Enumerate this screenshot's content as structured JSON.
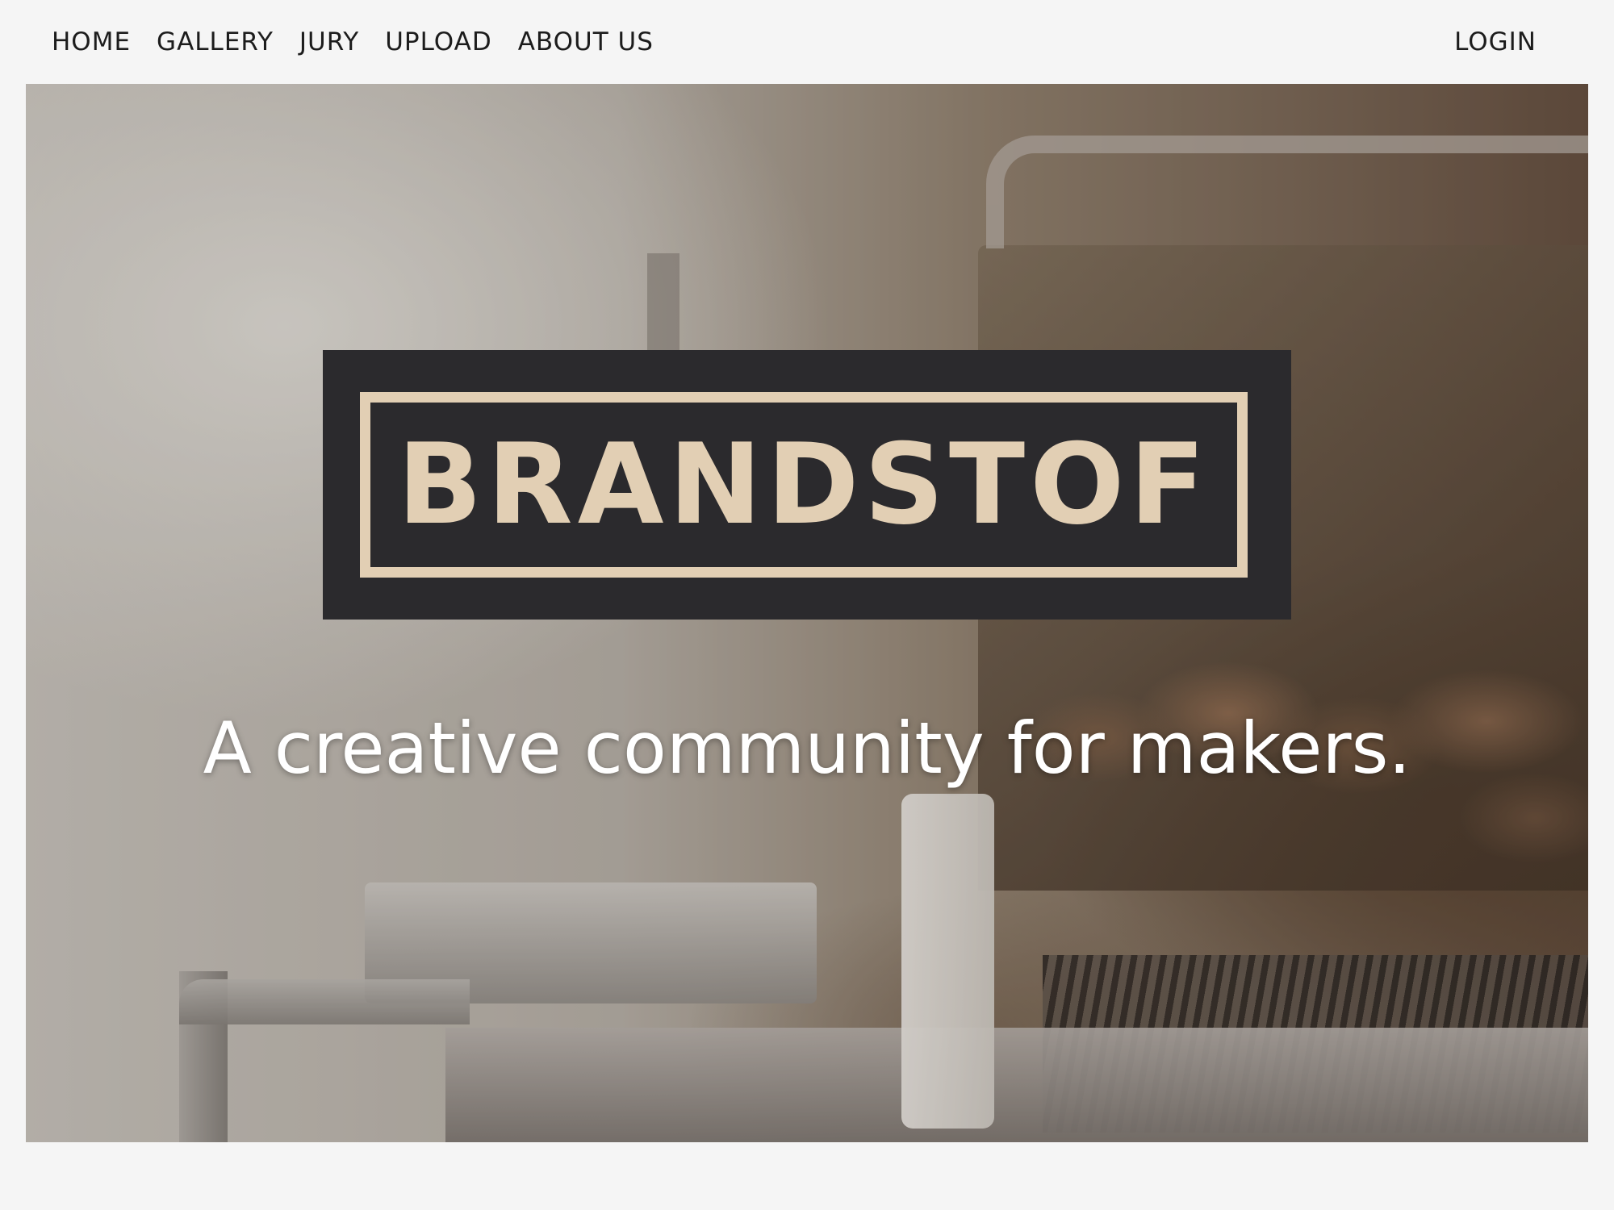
{
  "nav": {
    "items": [
      {
        "label": "HOME"
      },
      {
        "label": "GALLERY"
      },
      {
        "label": "JURY"
      },
      {
        "label": "UPLOAD"
      },
      {
        "label": "ABOUT US"
      }
    ],
    "login_label": "LOGIN"
  },
  "hero": {
    "logo_text": "BRANDSTOF",
    "tagline": "A creative community for makers."
  },
  "colors": {
    "page_background": "#f5f5f5",
    "nav_text": "#1c1c1c",
    "logo_background": "#2b2a2d",
    "logo_accent": "#e2cfb4",
    "tagline_text": "#ffffff"
  }
}
